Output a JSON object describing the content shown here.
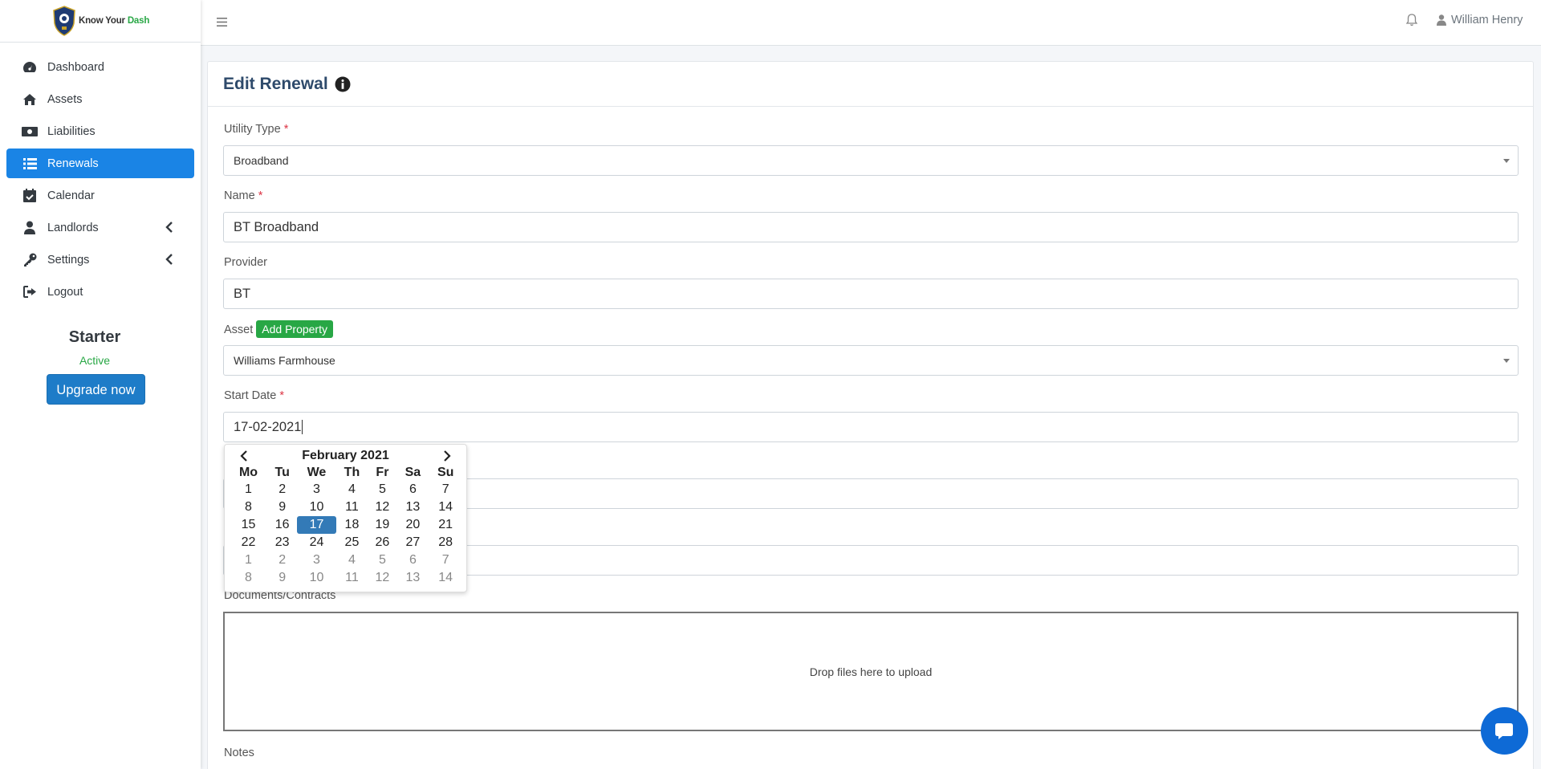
{
  "brand": {
    "name_part1": "Know Your ",
    "name_part2": "Dash"
  },
  "sidebar": {
    "items": [
      {
        "label": "Dashboard",
        "icon": "tachometer-icon"
      },
      {
        "label": "Assets",
        "icon": "home-icon"
      },
      {
        "label": "Liabilities",
        "icon": "money-bill-icon"
      },
      {
        "label": "Renewals",
        "icon": "list-icon",
        "active": true
      },
      {
        "label": "Calendar",
        "icon": "calendar-check-icon"
      },
      {
        "label": "Landlords",
        "icon": "user-tie-icon",
        "expandable": true
      },
      {
        "label": "Settings",
        "icon": "key-icon",
        "expandable": true
      },
      {
        "label": "Logout",
        "icon": "sign-out-icon"
      }
    ],
    "plan": {
      "name": "Starter",
      "status": "Active",
      "upgrade_label": "Upgrade now"
    }
  },
  "topbar": {
    "user_name": "William Henry"
  },
  "form": {
    "title": "Edit Renewal",
    "utility_type": {
      "label": "Utility Type",
      "required": "*",
      "value": "Broadband"
    },
    "name": {
      "label": "Name",
      "required": "*",
      "value": "BT Broadband"
    },
    "provider": {
      "label": "Provider",
      "value": "BT"
    },
    "asset": {
      "label": "Asset",
      "add_label": "Add Property",
      "value": "Williams Farmhouse"
    },
    "start_date": {
      "label": "Start Date",
      "required": "*",
      "value": "17-02-2021"
    },
    "documents": {
      "label": "Documents/Contracts",
      "dropzone_text": "Drop files here to upload"
    },
    "notes": {
      "label": "Notes"
    }
  },
  "datepicker": {
    "title": "February 2021",
    "weekdays": [
      "Mo",
      "Tu",
      "We",
      "Th",
      "Fr",
      "Sa",
      "Su"
    ],
    "weeks": [
      [
        "1",
        "2",
        "3",
        "4",
        "5",
        "6",
        "7"
      ],
      [
        "8",
        "9",
        "10",
        "11",
        "12",
        "13",
        "14"
      ],
      [
        "15",
        "16",
        "17",
        "18",
        "19",
        "20",
        "21"
      ],
      [
        "22",
        "23",
        "24",
        "25",
        "26",
        "27",
        "28"
      ],
      [
        "1",
        "2",
        "3",
        "4",
        "5",
        "6",
        "7"
      ],
      [
        "8",
        "9",
        "10",
        "11",
        "12",
        "13",
        "14"
      ]
    ],
    "selected_day": "17",
    "colors": {
      "selected": "#337ab7",
      "accent": "#1a84e5",
      "success": "#28a745"
    }
  }
}
